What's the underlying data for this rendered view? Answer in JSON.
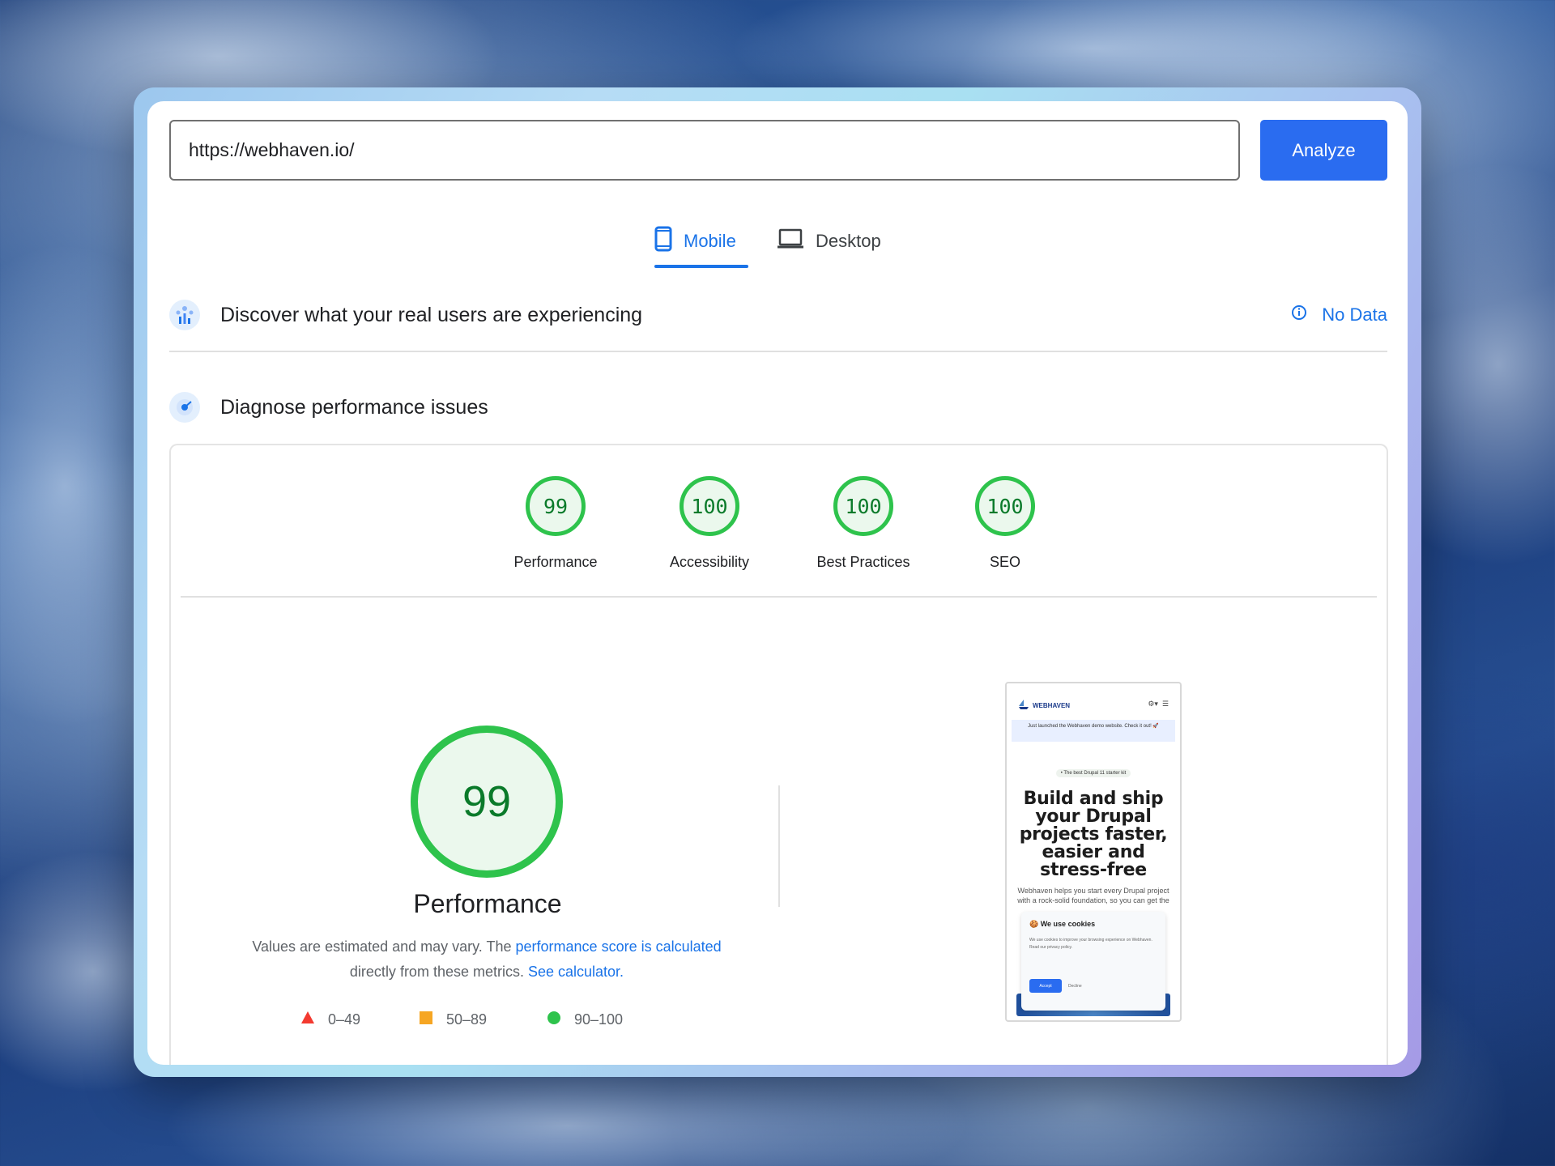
{
  "search": {
    "url_value": "https://webhaven.io/",
    "analyze_label": "Analyze"
  },
  "tabs": [
    {
      "label": "Mobile",
      "icon": "phone-icon",
      "active": true
    },
    {
      "label": "Desktop",
      "icon": "laptop-icon",
      "active": false
    }
  ],
  "field_data": {
    "title": "Discover what your real users are experiencing",
    "status_label": "No Data",
    "icon": "users-chart-icon",
    "status_icon": "info-icon"
  },
  "diagnose": {
    "title": "Diagnose performance issues",
    "icon": "radar-icon"
  },
  "scores": [
    {
      "value": "99",
      "label": "Performance"
    },
    {
      "value": "100",
      "label": "Accessibility"
    },
    {
      "value": "100",
      "label": "Best Practices"
    },
    {
      "value": "100",
      "label": "SEO"
    }
  ],
  "performance": {
    "score": "99",
    "label": "Performance",
    "desc_prefix": "Values are estimated and may vary. The ",
    "desc_link1": "performance score is calculated",
    "desc_middle": " directly from these metrics. ",
    "desc_link2": "See calculator."
  },
  "legend": [
    {
      "range": "0–49",
      "shape": "triangle",
      "color": "#f33a30"
    },
    {
      "range": "50–89",
      "shape": "square",
      "color": "#f6a623"
    },
    {
      "range": "90–100",
      "shape": "circle",
      "color": "#2ec34c"
    }
  ],
  "screenshot": {
    "brand": "WEBHAVEN",
    "banner": "Just launched the Webhaven demo website. Check it out! 🚀",
    "pill": "• The best Drupal 11 starter kit",
    "headline": "Build and ship your Drupal projects faster, easier and stress-free",
    "subtext": "Webhaven helps you start every Drupal project with a rock-solid foundation, so you can get the best out of your website",
    "cookie_title": "We use cookies",
    "cookie_text": "We use cookies to improve your browsing experience on Webhaven. Read our privacy policy.",
    "accept_label": "Accept",
    "decline_label": "Decline"
  },
  "colors": {
    "accent": "#1a73e8",
    "button": "#2a6cf0",
    "pass_green": "#2ec34c"
  }
}
